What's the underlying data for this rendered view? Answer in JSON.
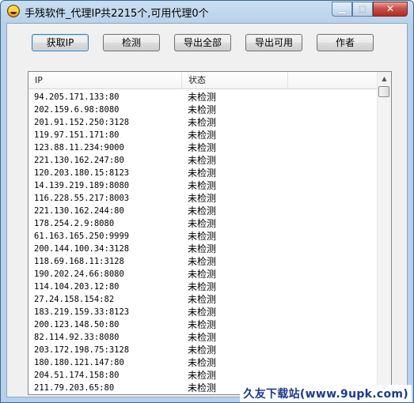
{
  "window": {
    "title": "手残软件_代理IP共2215个,可用代理0个"
  },
  "toolbar": {
    "buttons": [
      {
        "label": "获取IP"
      },
      {
        "label": "检测"
      },
      {
        "label": "导出全部"
      },
      {
        "label": "导出可用"
      },
      {
        "label": "作者"
      }
    ]
  },
  "list": {
    "columns": [
      "IP",
      "状态"
    ],
    "rows": [
      {
        "ip": "94.205.171.133:80",
        "status": "未检测"
      },
      {
        "ip": "202.159.6.98:8080",
        "status": "未检测"
      },
      {
        "ip": "201.91.152.250:3128",
        "status": "未检测"
      },
      {
        "ip": "119.97.151.171:80",
        "status": "未检测"
      },
      {
        "ip": "123.88.11.234:9000",
        "status": "未检测"
      },
      {
        "ip": "221.130.162.247:80",
        "status": "未检测"
      },
      {
        "ip": "120.203.180.15:8123",
        "status": "未检测"
      },
      {
        "ip": "14.139.219.189:8080",
        "status": "未检测"
      },
      {
        "ip": "116.228.55.217:8003",
        "status": "未检测"
      },
      {
        "ip": "221.130.162.244:80",
        "status": "未检测"
      },
      {
        "ip": "178.254.2.9:8080",
        "status": "未检测"
      },
      {
        "ip": "61.163.165.250:9999",
        "status": "未检测"
      },
      {
        "ip": "200.144.100.34:3128",
        "status": "未检测"
      },
      {
        "ip": "118.69.168.11:3128",
        "status": "未检测"
      },
      {
        "ip": "190.202.24.66:8080",
        "status": "未检测"
      },
      {
        "ip": "114.104.203.12:80",
        "status": "未检测"
      },
      {
        "ip": "27.24.158.154:82",
        "status": "未检测"
      },
      {
        "ip": "183.219.159.33:8123",
        "status": "未检测"
      },
      {
        "ip": "200.123.148.50:80",
        "status": "未检测"
      },
      {
        "ip": "82.114.92.33:8080",
        "status": "未检测"
      },
      {
        "ip": "203.172.198.75:3128",
        "status": "未检测"
      },
      {
        "ip": "180.180.121.147:80",
        "status": "未检测"
      },
      {
        "ip": "204.51.174.158:80",
        "status": "未检测"
      },
      {
        "ip": "211.79.203.65:80",
        "status": "未检测"
      }
    ]
  },
  "watermark": "久友下载站(www.9upk.com)"
}
